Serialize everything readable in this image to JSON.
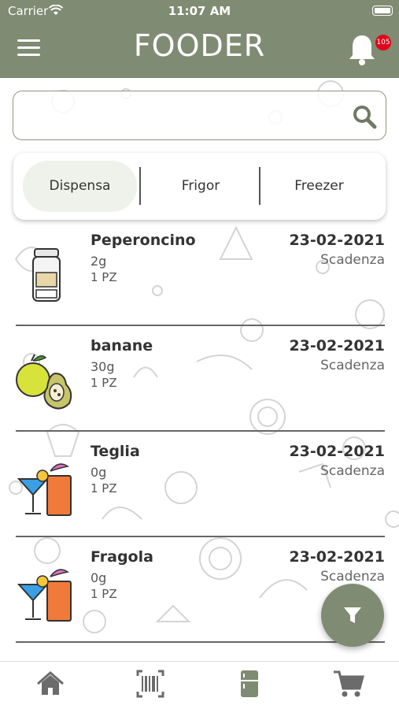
{
  "status": {
    "carrier": "Carrier",
    "time": "11:07 AM"
  },
  "header": {
    "title": "FOODER",
    "notification_count": "105"
  },
  "search": {
    "placeholder": ""
  },
  "segments": [
    {
      "label": "Dispensa",
      "active": true
    },
    {
      "label": "Frigor",
      "active": false
    },
    {
      "label": "Freezer",
      "active": false
    }
  ],
  "items": [
    {
      "name": "Peperoncino",
      "qty": "2g",
      "unit": "1 PZ",
      "date": "23-02-2021",
      "expiry_label": "Scadenza",
      "icon": "jar-icon"
    },
    {
      "name": "banane",
      "qty": "30g",
      "unit": "1 PZ",
      "date": "23-02-2021",
      "expiry_label": "Scadenza",
      "icon": "fruit-icon"
    },
    {
      "name": "Teglia",
      "qty": "0g",
      "unit": "1 PZ",
      "date": "23-02-2021",
      "expiry_label": "Scadenza",
      "icon": "drinks-icon"
    },
    {
      "name": "Fragola",
      "qty": "0g",
      "unit": "1 PZ",
      "date": "23-02-2021",
      "expiry_label": "Scadenza",
      "icon": "drinks-icon"
    }
  ],
  "nav": [
    "home-icon",
    "barcode-icon",
    "fridge-icon",
    "cart-icon"
  ],
  "colors": {
    "header": "#7f8b72",
    "badge": "#e3001b",
    "active_segment": "#eef2ea",
    "nav_icon": "#6b6b6b"
  }
}
